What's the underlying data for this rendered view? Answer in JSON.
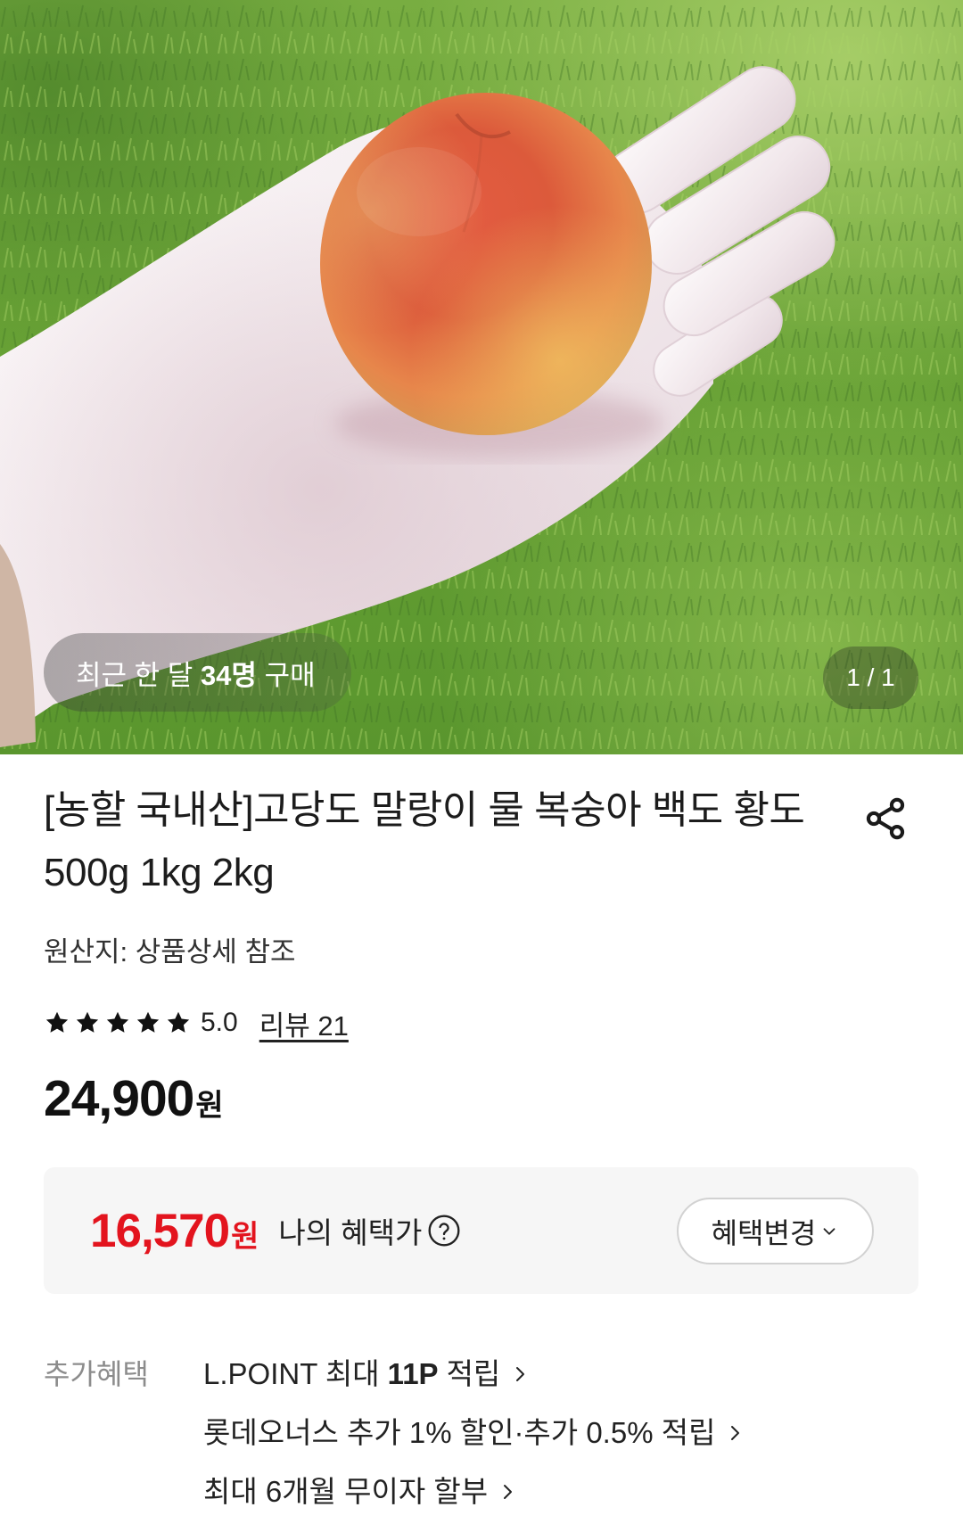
{
  "hero": {
    "purchase_badge": {
      "prefix": "최근 한 달",
      "count": "34명",
      "suffix": "구매"
    },
    "image_counter": "1 / 1"
  },
  "product": {
    "title": "[농할 국내산]고당도 말랑이 물 복숭아 백도 황도 500g 1kg 2kg",
    "origin": "원산지: 상품상세 참조",
    "rating": {
      "filled_stars": 5,
      "score": "5.0",
      "review_link": "리뷰 21"
    },
    "price": {
      "amount": "24,900",
      "unit": "원"
    }
  },
  "benefit_price": {
    "amount": "16,570",
    "unit": "원",
    "label": "나의 혜택가",
    "change_button": "혜택변경"
  },
  "extra_benefits": {
    "label": "추가혜택",
    "items": [
      {
        "text": "L.POINT 최대",
        "highlight": "11P",
        "text_after": "적립"
      },
      {
        "text": "롯데오너스 추가 1% 할인·추가 0.5% 적립"
      },
      {
        "text": "최대 6개월 무이자 할부"
      }
    ]
  },
  "icons": {
    "share": "share-icon",
    "star": "star-icon",
    "help": "question-circle-icon",
    "change_button_arrow": "chevron-down-icon",
    "list_arrow": "chevron-right-icon"
  },
  "colors": {
    "benefit_price": "#e3141e",
    "text": "#1a1a1a",
    "muted_text": "#8c8c8c",
    "benefit_box_background": "#f6f6f6",
    "button_border": "#d2d2d2"
  }
}
